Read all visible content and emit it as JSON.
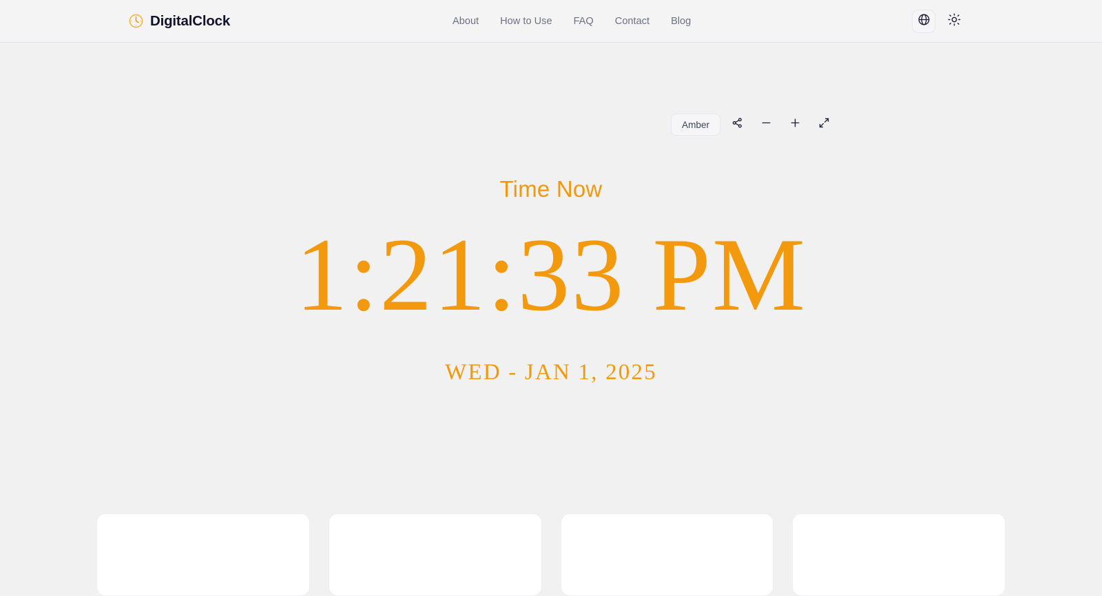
{
  "theme": {
    "accent": "#f2990d",
    "page_background": "#f1f1f1",
    "header_background": "#f4f4f5",
    "text_dark": "#11132a",
    "text_muted": "#6b7280",
    "card_background": "#ffffff"
  },
  "header": {
    "brand": {
      "name": "DigitalClock",
      "icon": "clock-icon"
    },
    "nav": [
      {
        "label": "About"
      },
      {
        "label": "How to Use"
      },
      {
        "label": "FAQ"
      },
      {
        "label": "Contact"
      },
      {
        "label": "Blog"
      }
    ],
    "actions": [
      {
        "icon": "globe-icon",
        "name": "language-selector"
      },
      {
        "icon": "sun-icon",
        "name": "theme-toggle"
      }
    ]
  },
  "toolbar": {
    "theme_name": "Amber",
    "buttons": [
      {
        "icon": "share-icon",
        "name": "share-button"
      },
      {
        "icon": "minus-icon",
        "name": "decrease-size-button",
        "glyph": "−"
      },
      {
        "icon": "plus-icon",
        "name": "increase-size-button",
        "glyph": "+"
      },
      {
        "icon": "expand-icon",
        "name": "fullscreen-button"
      }
    ]
  },
  "clock": {
    "label": "Time Now",
    "time": "1:21:33 PM",
    "date": "WED - JAN 1, 2025"
  },
  "cards": [
    {
      "id": "card-1"
    },
    {
      "id": "card-2"
    },
    {
      "id": "card-3"
    },
    {
      "id": "card-4"
    }
  ]
}
